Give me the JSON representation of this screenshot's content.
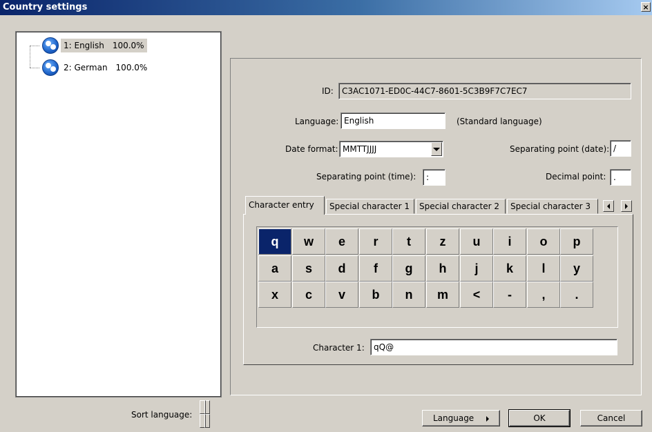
{
  "window": {
    "title": "Country settings",
    "close_glyph": "×"
  },
  "tree": {
    "items": [
      {
        "label": "1: English",
        "percent": "100.0%",
        "icon": "language-globe-icon",
        "selected": true
      },
      {
        "label": "2: German",
        "percent": "100.0%",
        "icon": "language-globe-icon",
        "selected": false
      }
    ]
  },
  "form": {
    "id_label": "ID:",
    "id_value": "C3AC1071-ED0C-44C7-8601-5C3B9F7C7EC7",
    "language_label": "Language:",
    "language_value": "English",
    "standard_note": "(Standard language)",
    "date_format_label": "Date format:",
    "date_format_value": "MMTTJJJJ",
    "sep_date_label": "Separating point (date):",
    "sep_date_value": "/",
    "sep_time_label": "Separating point (time):",
    "sep_time_value": ":",
    "decimal_label": "Decimal point:",
    "decimal_value": "."
  },
  "tabs": [
    "Character entry",
    "Special character 1",
    "Special character 2",
    "Special character 3"
  ],
  "keyboard": {
    "rows": [
      [
        "q",
        "w",
        "e",
        "r",
        "t",
        "z",
        "u",
        "i",
        "o",
        "p"
      ],
      [
        "a",
        "s",
        "d",
        "f",
        "g",
        "h",
        "j",
        "k",
        "l",
        "y"
      ],
      [
        "x",
        "c",
        "v",
        "b",
        "n",
        "m",
        "<",
        "-",
        ",",
        "."
      ]
    ],
    "selected": "q"
  },
  "character": {
    "label": "Character 1:",
    "value": "qQ@"
  },
  "footer": {
    "sort_label": "Sort language:",
    "language_button": "Language",
    "ok_button": "OK",
    "cancel_button": "Cancel"
  },
  "colors": {
    "face": "#d4d0c8",
    "title_start": "#0a246a",
    "title_end": "#a6caf0",
    "selected_key": "#0a246a"
  }
}
